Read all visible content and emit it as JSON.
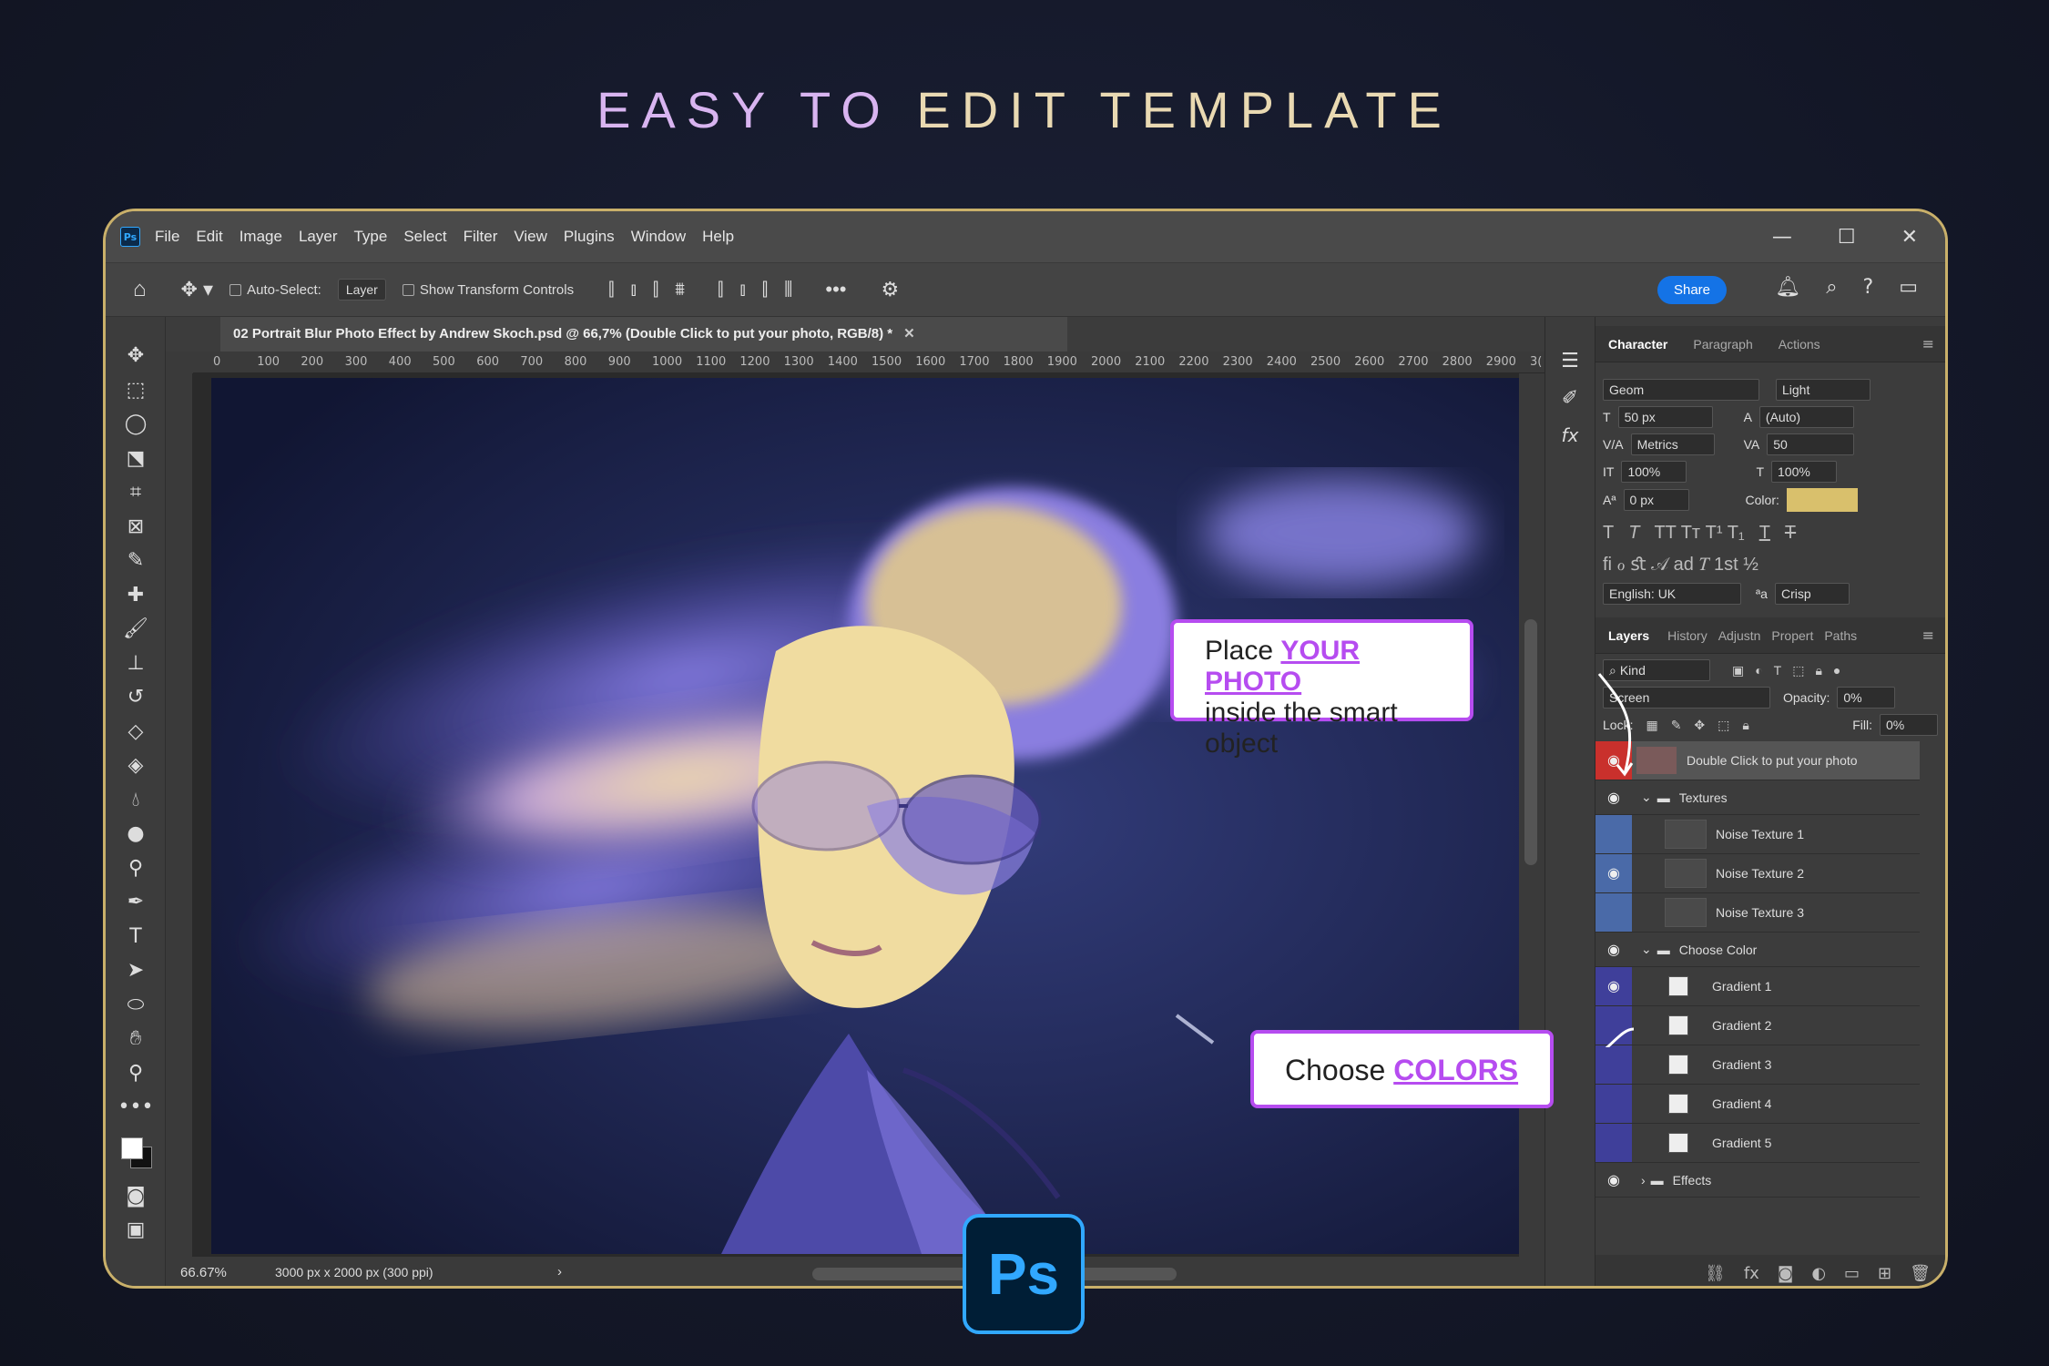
{
  "headline": {
    "part1": "EASY TO ",
    "part2": "EDIT TEMPLATE"
  },
  "menu": [
    "File",
    "Edit",
    "Image",
    "Layer",
    "Type",
    "Select",
    "Filter",
    "View",
    "Plugins",
    "Window",
    "Help"
  ],
  "options": {
    "auto_select": "Auto-Select:",
    "layer_select": "Layer",
    "show_transform": "Show Transform Controls",
    "share": "Share"
  },
  "document": {
    "tab_title": "02 Portrait Blur Photo Effect by Andrew Skoch.psd @ 66,7% (Double Click to put your photo, RGB/8) *",
    "zoom": "66.67%",
    "size": "3000 px x 2000 px (300 ppi)"
  },
  "ruler": [
    "0",
    "100",
    "200",
    "300",
    "400",
    "500",
    "600",
    "700",
    "800",
    "900",
    "1000",
    "1100",
    "1200",
    "1300",
    "1400",
    "1500",
    "1600",
    "1700",
    "1800",
    "1900",
    "2000",
    "2100",
    "2200",
    "2300",
    "2400",
    "2500",
    "2600",
    "2700",
    "2800",
    "2900",
    "3("
  ],
  "character": {
    "tabs": [
      "Character",
      "Paragraph",
      "Actions"
    ],
    "font": "Geom",
    "weight": "Light",
    "size": "50 px",
    "leading": "(Auto)",
    "kerning": "Metrics",
    "tracking": "50",
    "vscale": "100%",
    "hscale": "100%",
    "baseline": "0 px",
    "color_label": "Color:",
    "color": "#d9c06c",
    "language": "English: UK",
    "aa_label": "ªa",
    "aa": "Crisp"
  },
  "layers_panel": {
    "tabs": [
      "Layers",
      "History",
      "Adjustn",
      "Propert",
      "Paths"
    ],
    "kind": "Kind",
    "blend": "Screen",
    "opacity_label": "Opacity:",
    "opacity": "0%",
    "lock_label": "Lock:",
    "fill_label": "Fill:",
    "fill": "0%"
  },
  "layers": [
    {
      "name": "Double Click to put your photo",
      "type": "smart",
      "visible": true
    },
    {
      "name": "Textures",
      "type": "group",
      "visible": true
    },
    {
      "name": "Noise Texture 1",
      "type": "layer",
      "visible": false
    },
    {
      "name": "Noise Texture 2",
      "type": "layer",
      "visible": true
    },
    {
      "name": "Noise Texture 3",
      "type": "layer",
      "visible": false
    },
    {
      "name": "Choose Color",
      "type": "group",
      "visible": true
    },
    {
      "name": "Gradient 1",
      "type": "gradient",
      "visible": true
    },
    {
      "name": "Gradient 2",
      "type": "gradient",
      "visible": false
    },
    {
      "name": "Gradient 3",
      "type": "gradient",
      "visible": false
    },
    {
      "name": "Gradient 4",
      "type": "gradient",
      "visible": false
    },
    {
      "name": "Gradient 5",
      "type": "gradient",
      "visible": false
    },
    {
      "name": "Effects",
      "type": "group",
      "visible": true
    }
  ],
  "callout1": {
    "line1a": "Place ",
    "line1b": "YOUR PHOTO",
    "line2": "inside the smart object"
  },
  "callout2": {
    "a": "Choose ",
    "b": "COLORS"
  },
  "ps_logo": "Ps",
  "colors": {
    "accent": "#b64cf0",
    "frame": "#c9b06a",
    "share": "#1473e6",
    "sel_layer": "#c9302c",
    "group_eye": "#4a6aa8",
    "gradient_eye": "#3f3f9a"
  }
}
